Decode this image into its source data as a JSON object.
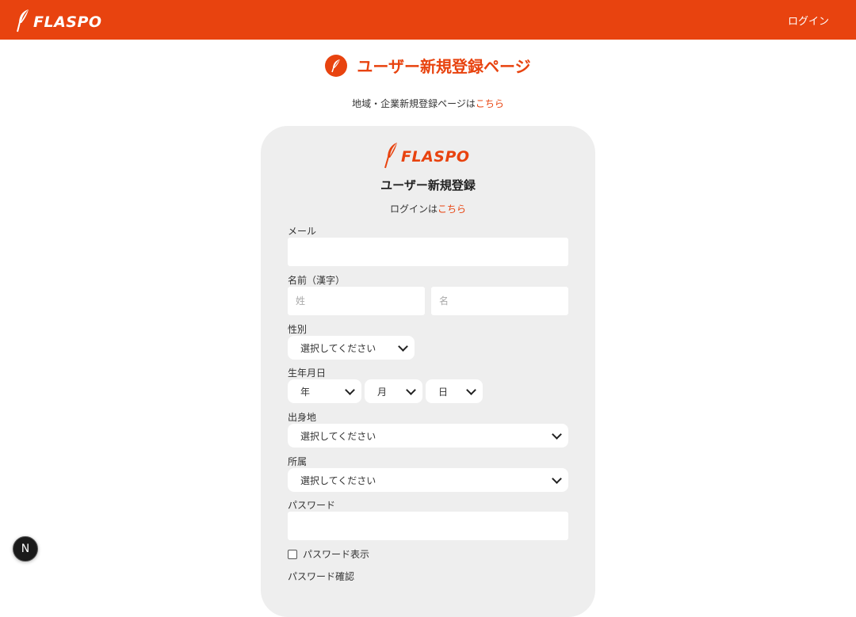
{
  "header": {
    "logo_text": "FLASPO",
    "login_label": "ログイン",
    "brand_color": "#e8430f"
  },
  "page": {
    "title": "ユーザー新規登録ページ",
    "title_icon": "feather-icon",
    "company_signup_text": "地域・企業新規登録ページは",
    "company_signup_link": "こちら"
  },
  "card": {
    "logo_text": "FLASPO",
    "title": "ユーザー新規登録",
    "login_text": "ログインは",
    "login_link": "こちら",
    "fields": {
      "email_label": "メール",
      "email_value": "",
      "name_label": "名前（漢字）",
      "last_name_placeholder": "姓",
      "first_name_placeholder": "名",
      "gender_label": "性別",
      "gender_value": "選択してください",
      "birthday_label": "生年月日",
      "birth_year_value": "年",
      "birth_month_value": "月",
      "birth_day_value": "日",
      "hometown_label": "出身地",
      "hometown_value": "選択してください",
      "affiliation_label": "所属",
      "affiliation_value": "選択してください",
      "password_label": "パスワード",
      "password_value": "",
      "show_password_label": "パスワード表示",
      "password_confirm_label": "パスワード確認"
    }
  },
  "dev_badge": {
    "letter": "N"
  }
}
